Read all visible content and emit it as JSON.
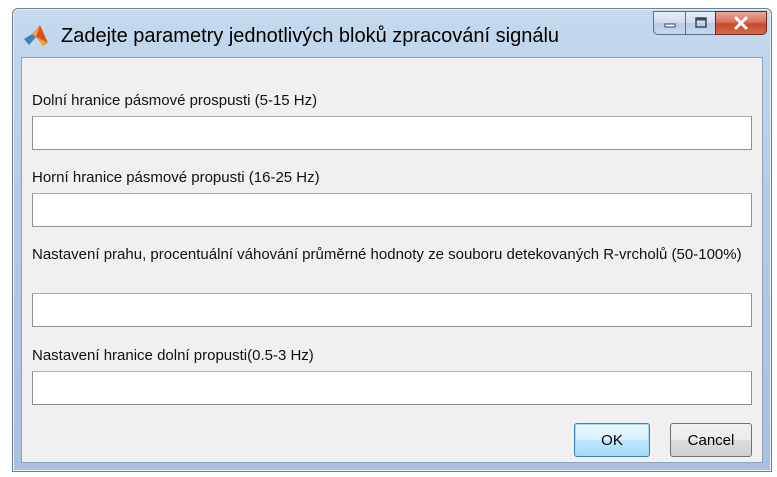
{
  "window": {
    "title": "Zadejte parametry jednotlivých bloků zpracování signálu",
    "icon": "matlab-icon"
  },
  "caption_buttons": {
    "minimize": "minimize-icon",
    "maximize": "maximize-icon",
    "close": "close-icon"
  },
  "fields": [
    {
      "label": "Dolní hranice pásmové prospusti (5-15 Hz)",
      "value": ""
    },
    {
      "label": "Horní hranice pásmové propusti (16-25 Hz)",
      "value": ""
    },
    {
      "label": "Nastavení prahu, procentuální váhování průměrné hodnoty ze souboru detekovaných R-vrcholů (50-100%)",
      "value": ""
    },
    {
      "label": "Nastavení hranice dolní propusti(0.5-3 Hz)",
      "value": ""
    }
  ],
  "buttons": {
    "ok": "OK",
    "cancel": "Cancel"
  },
  "colors": {
    "titlebar": "#b4cbe5",
    "client_bg": "#f0f0f0",
    "close_button": "#c44a2e",
    "ok_border": "#3c7fb1"
  }
}
